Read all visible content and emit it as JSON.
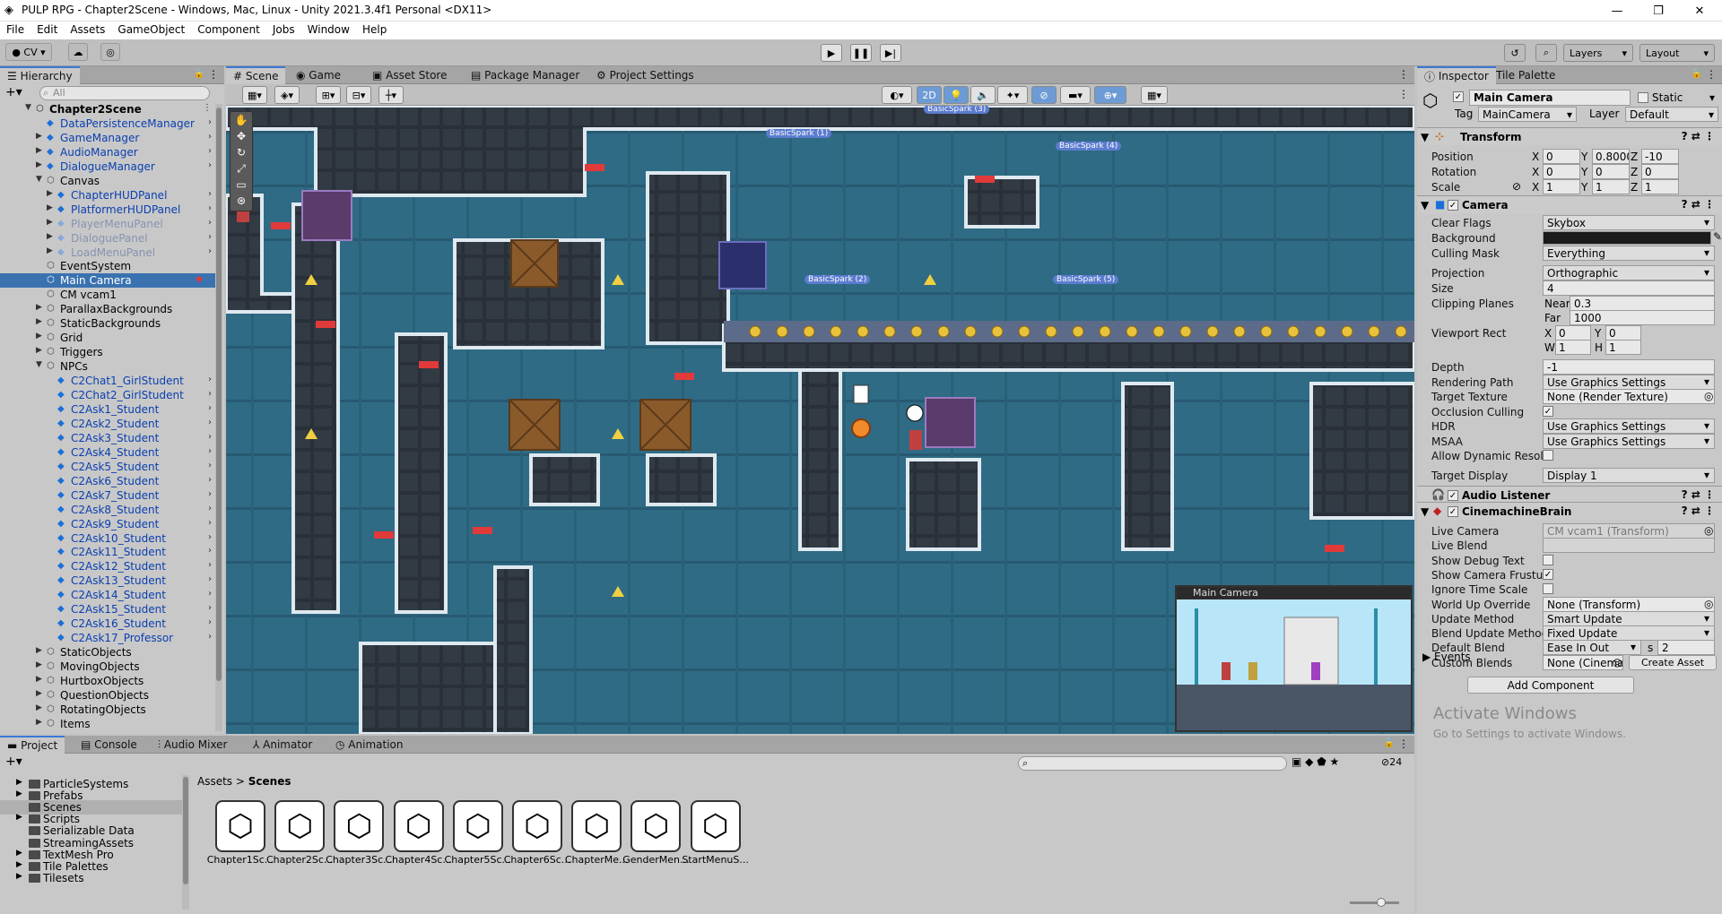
{
  "window": {
    "title": "PULP RPG - Chapter2Scene - Windows, Mac, Linux - Unity 2021.3.4f1 Personal <DX11>",
    "min": "—",
    "max": "❐",
    "close": "✕"
  },
  "menu": [
    "File",
    "Edit",
    "Assets",
    "GameObject",
    "Component",
    "Jobs",
    "Window",
    "Help"
  ],
  "toolbar": {
    "account": "CV",
    "layers": "Layers",
    "layout": "Layout"
  },
  "hierarchy": {
    "tab": "Hierarchy",
    "search_placeholder": "All",
    "items": [
      {
        "label": "Chapter2Scene",
        "indent": 0,
        "type": "scene",
        "arrow": "▼"
      },
      {
        "label": "DataPersistenceManager",
        "indent": 1,
        "type": "prefab",
        "arrow": "",
        "more": true
      },
      {
        "label": "GameManager",
        "indent": 1,
        "type": "prefab",
        "arrow": "▶",
        "more": true
      },
      {
        "label": "AudioManager",
        "indent": 1,
        "type": "prefab",
        "arrow": "▶",
        "more": true
      },
      {
        "label": "DialogueManager",
        "indent": 1,
        "type": "prefab",
        "arrow": "▶",
        "more": true
      },
      {
        "label": "Canvas",
        "indent": 1,
        "type": "object",
        "arrow": "▼"
      },
      {
        "label": "ChapterHUDPanel",
        "indent": 2,
        "type": "prefab",
        "arrow": "▶",
        "more": true
      },
      {
        "label": "PlatformerHUDPanel",
        "indent": 2,
        "type": "prefab",
        "arrow": "▶",
        "more": true
      },
      {
        "label": "PlayerMenuPanel",
        "indent": 2,
        "type": "disabled",
        "arrow": "▶",
        "more": true
      },
      {
        "label": "DialoguePanel",
        "indent": 2,
        "type": "disabled",
        "arrow": "▶",
        "more": true
      },
      {
        "label": "LoadMenuPanel",
        "indent": 2,
        "type": "disabled",
        "arrow": "▶",
        "more": true
      },
      {
        "label": "EventSystem",
        "indent": 1,
        "type": "object",
        "arrow": ""
      },
      {
        "label": "Main Camera",
        "indent": 1,
        "type": "object",
        "arrow": "",
        "selected": true
      },
      {
        "label": "CM vcam1",
        "indent": 1,
        "type": "object",
        "arrow": ""
      },
      {
        "label": "ParallaxBackgrounds",
        "indent": 1,
        "type": "object",
        "arrow": "▶"
      },
      {
        "label": "StaticBackgrounds",
        "indent": 1,
        "type": "object",
        "arrow": "▶"
      },
      {
        "label": "Grid",
        "indent": 1,
        "type": "object",
        "arrow": "▶"
      },
      {
        "label": "Triggers",
        "indent": 1,
        "type": "object",
        "arrow": "▶"
      },
      {
        "label": "NPCs",
        "indent": 1,
        "type": "object",
        "arrow": "▼"
      },
      {
        "label": "C2Chat1_GirlStudent",
        "indent": 2,
        "type": "prefab",
        "arrow": "",
        "more": true
      },
      {
        "label": "C2Chat2_GirlStudent",
        "indent": 2,
        "type": "prefab",
        "arrow": "",
        "more": true
      },
      {
        "label": "C2Ask1_Student",
        "indent": 2,
        "type": "prefab",
        "arrow": "",
        "more": true
      },
      {
        "label": "C2Ask2_Student",
        "indent": 2,
        "type": "prefab",
        "arrow": "",
        "more": true
      },
      {
        "label": "C2Ask3_Student",
        "indent": 2,
        "type": "prefab",
        "arrow": "",
        "more": true
      },
      {
        "label": "C2Ask4_Student",
        "indent": 2,
        "type": "prefab",
        "arrow": "",
        "more": true
      },
      {
        "label": "C2Ask5_Student",
        "indent": 2,
        "type": "prefab",
        "arrow": "",
        "more": true
      },
      {
        "label": "C2Ask6_Student",
        "indent": 2,
        "type": "prefab",
        "arrow": "",
        "more": true
      },
      {
        "label": "C2Ask7_Student",
        "indent": 2,
        "type": "prefab",
        "arrow": "",
        "more": true
      },
      {
        "label": "C2Ask8_Student",
        "indent": 2,
        "type": "prefab",
        "arrow": "",
        "more": true
      },
      {
        "label": "C2Ask9_Student",
        "indent": 2,
        "type": "prefab",
        "arrow": "",
        "more": true
      },
      {
        "label": "C2Ask10_Student",
        "indent": 2,
        "type": "prefab",
        "arrow": "",
        "more": true
      },
      {
        "label": "C2Ask11_Student",
        "indent": 2,
        "type": "prefab",
        "arrow": "",
        "more": true
      },
      {
        "label": "C2Ask12_Student",
        "indent": 2,
        "type": "prefab",
        "arrow": "",
        "more": true
      },
      {
        "label": "C2Ask13_Student",
        "indent": 2,
        "type": "prefab",
        "arrow": "",
        "more": true
      },
      {
        "label": "C2Ask14_Student",
        "indent": 2,
        "type": "prefab",
        "arrow": "",
        "more": true
      },
      {
        "label": "C2Ask15_Student",
        "indent": 2,
        "type": "prefab",
        "arrow": "",
        "more": true
      },
      {
        "label": "C2Ask16_Student",
        "indent": 2,
        "type": "prefab",
        "arrow": "",
        "more": true
      },
      {
        "label": "C2Ask17_Professor",
        "indent": 2,
        "type": "prefab",
        "arrow": "",
        "more": true
      },
      {
        "label": "StaticObjects",
        "indent": 1,
        "type": "object",
        "arrow": "▶"
      },
      {
        "label": "MovingObjects",
        "indent": 1,
        "type": "object",
        "arrow": "▶"
      },
      {
        "label": "HurtboxObjects",
        "indent": 1,
        "type": "object",
        "arrow": "▶"
      },
      {
        "label": "QuestionObjects",
        "indent": 1,
        "type": "object",
        "arrow": "▶"
      },
      {
        "label": "RotatingObjects",
        "indent": 1,
        "type": "object",
        "arrow": "▶"
      },
      {
        "label": "Items",
        "indent": 1,
        "type": "object",
        "arrow": "▶"
      }
    ]
  },
  "scene_tabs": [
    "Scene",
    "Game",
    "Asset Store",
    "Package Manager",
    "Project Settings"
  ],
  "scene": {
    "mode_2d": "2D",
    "camera_preview": "Main Camera",
    "labels": [
      "BasicSpark (1)",
      "BasicSpark (3)",
      "BasicSpark (4)",
      "BasicSpark (2)",
      "BasicSpark (5)"
    ]
  },
  "inspector": {
    "tabs": [
      "Inspector",
      "Tile Palette"
    ],
    "object_name": "Main Camera",
    "static_label": "Static",
    "tag_label": "Tag",
    "tag": "MainCamera",
    "layer_label": "Layer",
    "layer": "Default",
    "transform": {
      "title": "Transform",
      "position_label": "Position",
      "rotation_label": "Rotation",
      "scale_label": "Scale",
      "position": {
        "x": "0",
        "y": "0.8000",
        "z": "-10"
      },
      "rotation": {
        "x": "0",
        "y": "0",
        "z": "0"
      },
      "scale": {
        "x": "1",
        "y": "1",
        "z": "1"
      }
    },
    "camera": {
      "title": "Camera",
      "rows": [
        {
          "k": "Clear Flags",
          "v": "Skybox",
          "dd": true
        },
        {
          "k": "Background",
          "v": "",
          "color": true
        },
        {
          "k": "Culling Mask",
          "v": "Everything",
          "dd": true
        },
        {
          "k": "Projection",
          "v": "Orthographic",
          "dd": true
        },
        {
          "k": "Size",
          "v": "4"
        },
        {
          "k": "Clipping Planes",
          "sub": "Near",
          "v": "0.3"
        },
        {
          "k": "",
          "sub": "Far",
          "v": "1000"
        },
        {
          "k": "Viewport Rect",
          "xy": [
            "X",
            "0",
            "Y",
            "0"
          ]
        },
        {
          "k": "",
          "xy": [
            "W",
            "1",
            "H",
            "1"
          ]
        },
        {
          "k": "Depth",
          "v": "-1"
        },
        {
          "k": "Rendering Path",
          "v": "Use Graphics Settings",
          "dd": true
        },
        {
          "k": "Target Texture",
          "v": "None (Render Texture)",
          "obj": true
        },
        {
          "k": "Occlusion Culling",
          "check": true
        },
        {
          "k": "HDR",
          "v": "Use Graphics Settings",
          "dd": true
        },
        {
          "k": "MSAA",
          "v": "Use Graphics Settings",
          "dd": true
        },
        {
          "k": "Allow Dynamic Resol",
          "check": false
        },
        {
          "k": "Target Display",
          "v": "Display 1",
          "dd": true
        }
      ]
    },
    "audio_listener": "Audio Listener",
    "brain": {
      "title": "CinemachineBrain",
      "rows": [
        {
          "k": "Live Camera",
          "v": "CM vcam1 (Transform)",
          "dim": true,
          "obj": true
        },
        {
          "k": "Live Blend",
          "v": "",
          "dim": true
        },
        {
          "k": "Show Debug Text",
          "check": false
        },
        {
          "k": "Show Camera Frustur",
          "check": true
        },
        {
          "k": "Ignore Time Scale",
          "check": false
        },
        {
          "k": "World Up Override",
          "v": "None (Transform)",
          "obj": true
        },
        {
          "k": "Update Method",
          "v": "Smart Update",
          "dd": true
        },
        {
          "k": "Blend Update Methoc",
          "v": "Fixed Update",
          "dd": true
        },
        {
          "k": "Default Blend",
          "v": "Ease In Out",
          "dd": true,
          "s": "2"
        },
        {
          "k": "Custom Blends",
          "v": "None (Cinemac",
          "obj": true,
          "btn": "Create Asset"
        }
      ],
      "events": "Events"
    },
    "add_component": "Add Component",
    "activate_title": "Activate Windows",
    "activate_sub": "Go to Settings to activate Windows."
  },
  "bottom_tabs": [
    "Project",
    "Console",
    "Audio Mixer",
    "Animator",
    "Animation"
  ],
  "project": {
    "folders": [
      "ParticleSystems",
      "Prefabs",
      "Scenes",
      "Scripts",
      "Serializable Data",
      "StreamingAssets",
      "TextMesh Pro",
      "Tile Palettes",
      "Tilesets"
    ],
    "breadcrumb": [
      "Assets",
      "Scenes"
    ],
    "count": "24",
    "assets": [
      "Chapter1Sc...",
      "Chapter2Sc...",
      "Chapter3Sc...",
      "Chapter4Sc...",
      "Chapter5Sc...",
      "Chapter6Sc...",
      "ChapterMe...",
      "GenderMen...",
      "StartMenuS..."
    ]
  }
}
